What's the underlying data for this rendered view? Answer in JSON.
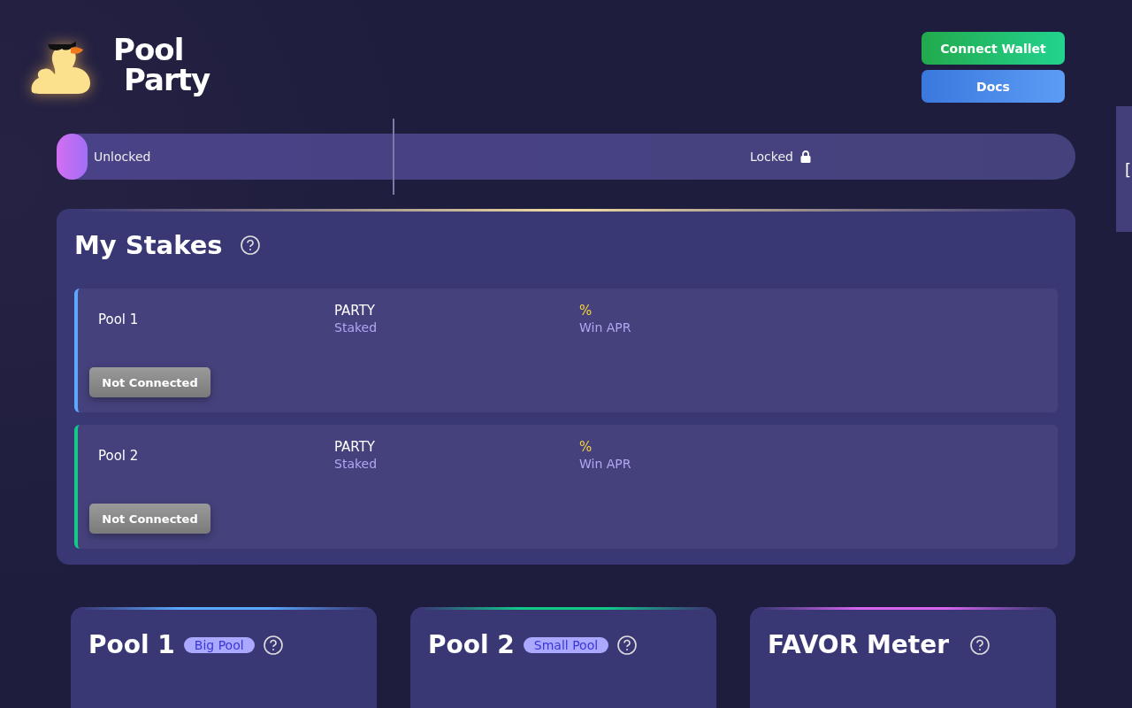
{
  "brand": {
    "line_1": "Pool",
    "line_2": "Party"
  },
  "header_buttons": [
    {
      "label": "Connect Wallet",
      "kind": "wallet"
    },
    {
      "label": "Docs",
      "kind": "docs"
    }
  ],
  "lock_slider": {
    "unlocked_label": "Unlocked",
    "locked_label": "Locked",
    "level": 0.03
  },
  "side_tab": {
    "label": "["
  },
  "my_stakes": {
    "title": "My Stakes",
    "rows": [
      {
        "pool": "Pool 1",
        "color": "#5aa8ff",
        "token": "PARTY",
        "token_caption": "Staked",
        "apr": "%",
        "apr_caption": "Win APR",
        "status": "Not Connected"
      },
      {
        "pool": "Pool 2",
        "color": "#12c98a",
        "token": "PARTY",
        "token_caption": "Staked",
        "apr": "%",
        "apr_caption": "Win APR",
        "status": "Not Connected"
      }
    ]
  },
  "cards": [
    {
      "title": "Pool 1",
      "badge": "Big Pool",
      "color": "#5aa8ff",
      "kind": "pool"
    },
    {
      "title": "Pool 2",
      "badge": "Small Pool",
      "color": "#12c98a",
      "kind": "pool"
    },
    {
      "title": "FAVOR Meter",
      "color": "#d765f0",
      "kind": "meter"
    }
  ]
}
